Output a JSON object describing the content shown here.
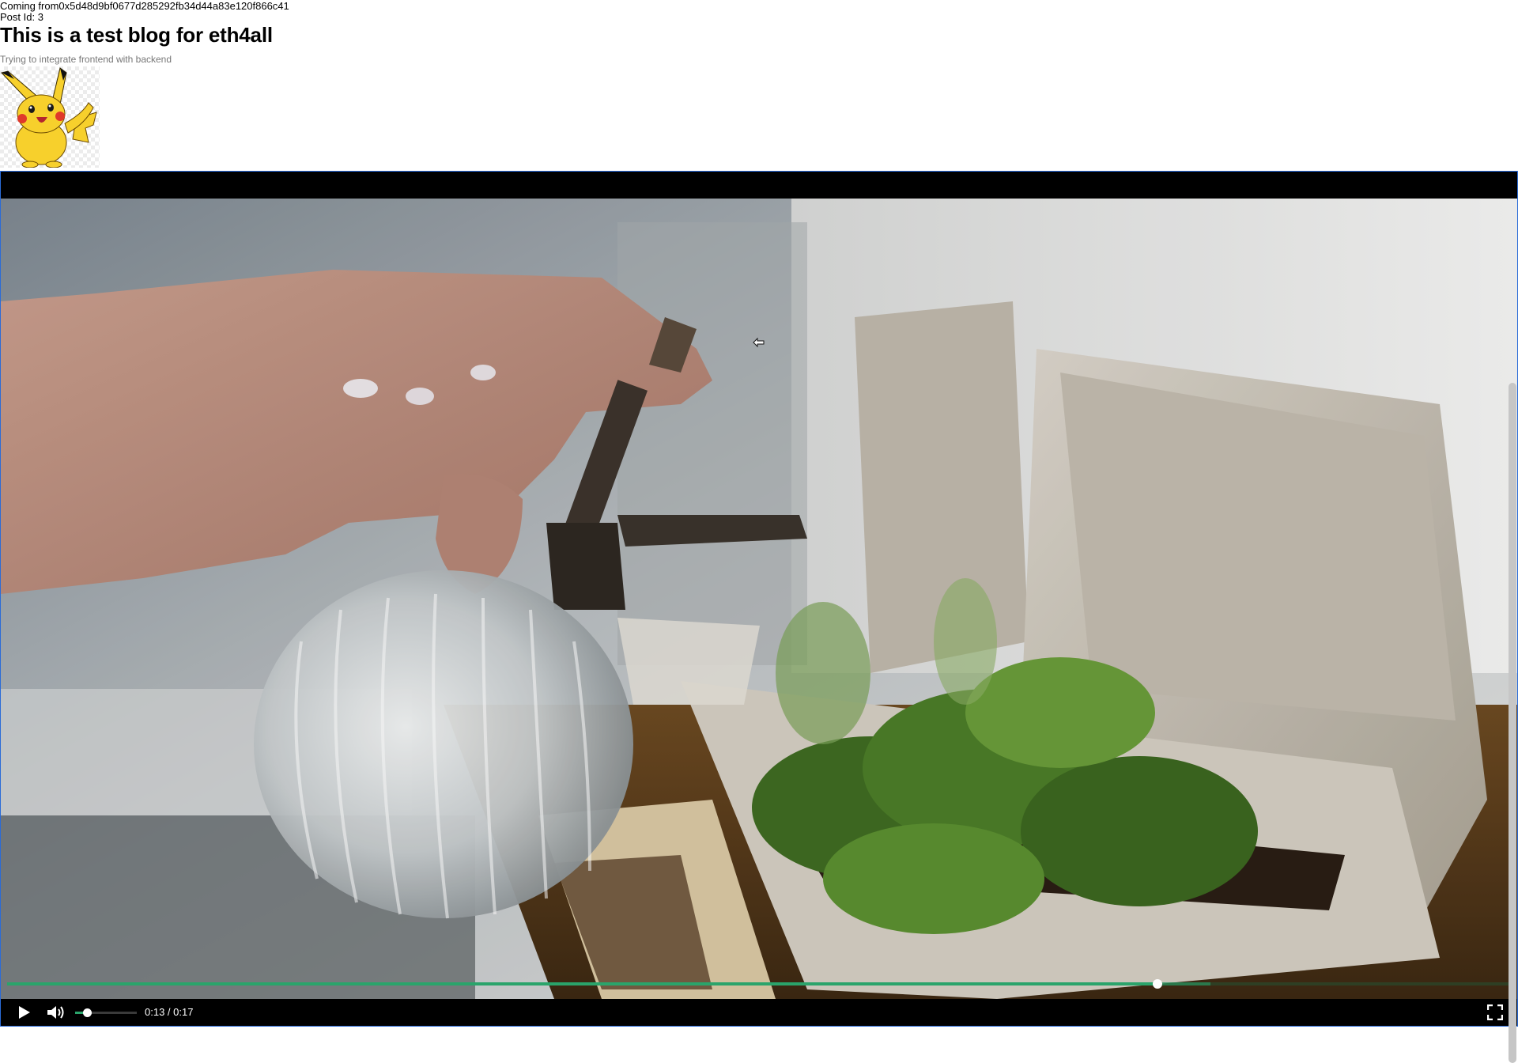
{
  "post": {
    "coming_from_prefix": "Coming from",
    "author_address": "0x5d48d9bf0677d285292fb34d44a83e120f866c41",
    "post_id_prefix": "Post Id: ",
    "post_id": "3",
    "title": "This is a test blog for eth4all",
    "subtitle": "Trying to integrate frontend with backend",
    "image_icon": "pikachu-image"
  },
  "video": {
    "current_time": "0:13",
    "separator": " / ",
    "duration": "0:17",
    "progress_fraction": 0.765,
    "buffered_fraction": 0.8,
    "volume_fraction": 0.19,
    "accent_color": "#2aa46b",
    "icons": {
      "play": "play-icon",
      "volume": "volume-icon",
      "fullscreen": "fullscreen-icon"
    }
  }
}
